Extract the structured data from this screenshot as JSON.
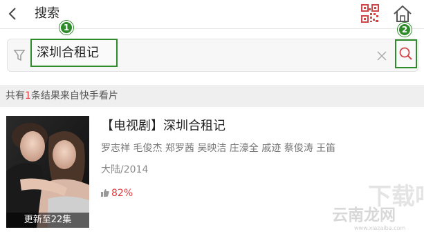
{
  "header": {
    "title": "搜索",
    "back_icon": "chevron-left-icon",
    "qr_icon": "qr-code-icon",
    "home_icon": "home-icon"
  },
  "markers": {
    "first": "1",
    "second": "2"
  },
  "search": {
    "filter_icon": "filter-icon",
    "query": "深圳合租记",
    "clear_icon": "close-icon",
    "search_icon": "search-icon"
  },
  "summary": {
    "prefix": "共有",
    "count": "1",
    "suffix": "条结果来自快手看片"
  },
  "result": {
    "title": "【电视剧】深圳合租记",
    "cast": "罗志祥 毛俊杰 郑罗茜 吴映洁 庄濠全 戚迹 蔡俊涛 王笛",
    "meta": "大陆/2014",
    "rating": "82%",
    "poster_caption": "更新至22集"
  },
  "watermark": {
    "logo_text": "云南龙网",
    "url": "www.xiazaiba.com"
  },
  "colors": {
    "accent_red": "#e23a3a",
    "highlight_green": "#2e8b2a"
  }
}
